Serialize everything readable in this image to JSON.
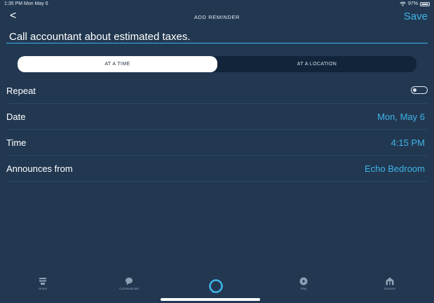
{
  "status_bar": {
    "time": "1:35 PM  Mon May 6",
    "battery": "97%"
  },
  "nav": {
    "back": "<",
    "title": "ADD REMINDER",
    "save": "Save"
  },
  "reminder": {
    "text": "Call accountant about estimated taxes."
  },
  "segments": [
    {
      "label": "AT A TIME",
      "active": true
    },
    {
      "label": "AT A LOCATION",
      "active": false
    }
  ],
  "rows": {
    "repeat": {
      "label": "Repeat",
      "toggle": "off"
    },
    "date": {
      "label": "Date",
      "value": "Mon, May 6"
    },
    "time": {
      "label": "Time",
      "value": "4:15 PM"
    },
    "announces": {
      "label": "Announces from",
      "value": "Echo Bedroom"
    }
  },
  "tabs": [
    {
      "label": "Home",
      "icon": "home-icon"
    },
    {
      "label": "Communicate",
      "icon": "speech-bubble-icon"
    },
    {
      "label": "",
      "icon": "alexa-icon"
    },
    {
      "label": "Play",
      "icon": "play-icon"
    },
    {
      "label": "Devices",
      "icon": "devices-icon"
    }
  ],
  "colors": {
    "background": "#223851",
    "accent": "#3fb3e8",
    "segment_bg": "#12243a",
    "divider": "#2e4662"
  }
}
